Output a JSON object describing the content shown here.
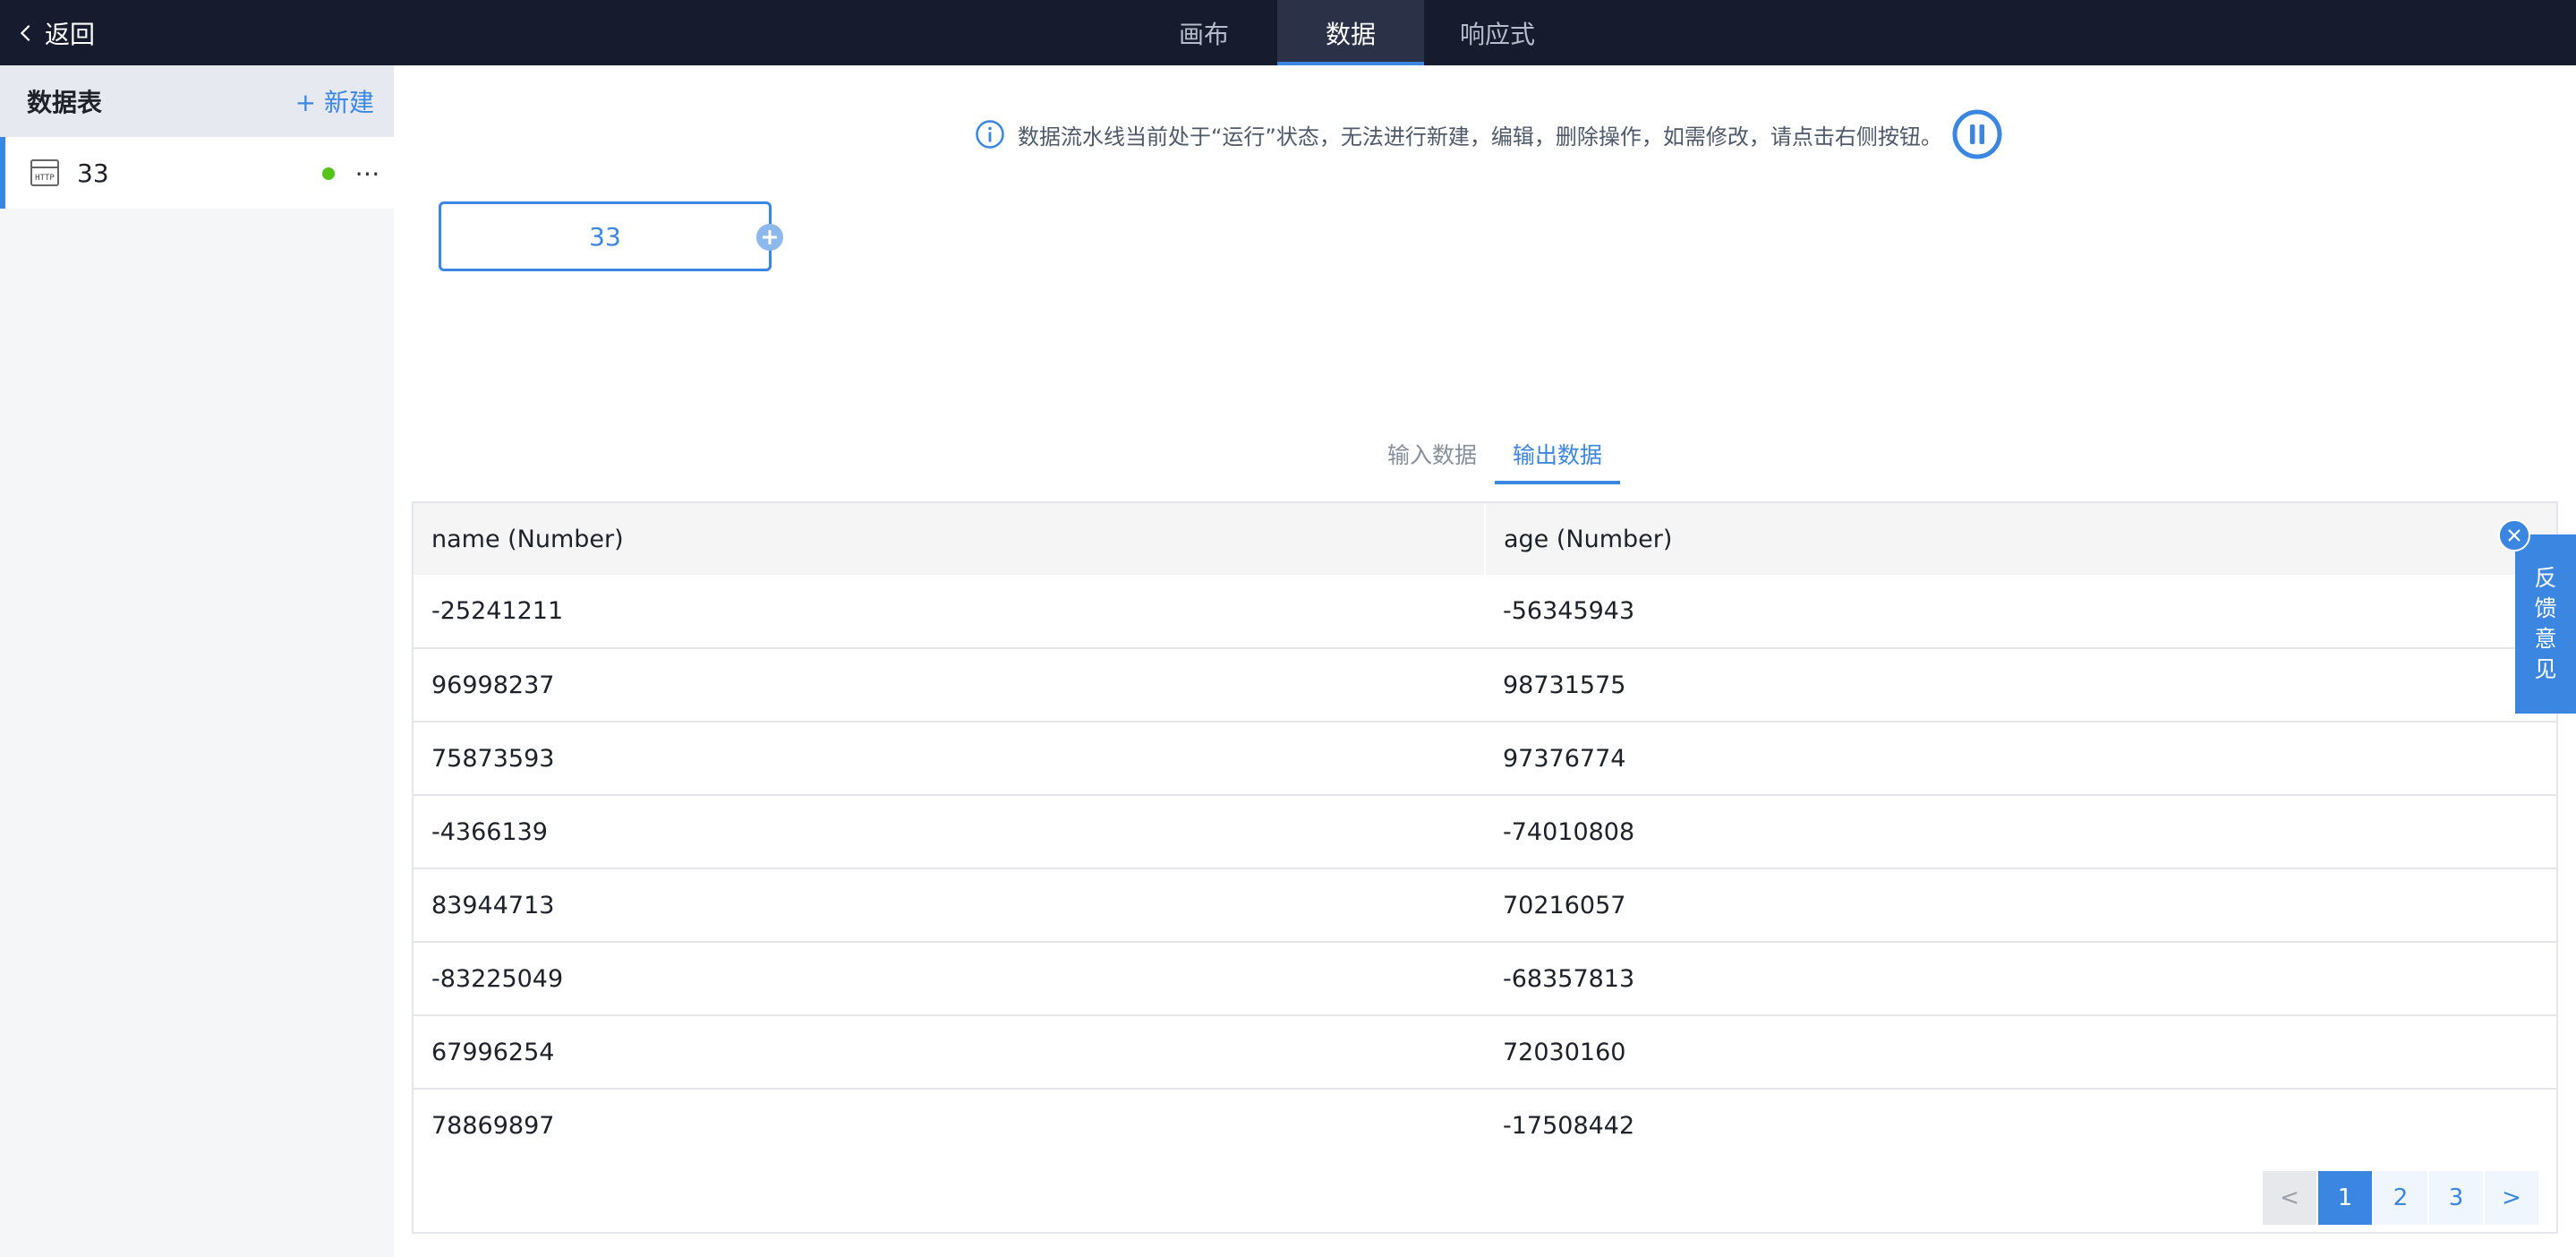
{
  "header": {
    "back_label": "返回",
    "tabs": [
      {
        "label": "画布",
        "active": false
      },
      {
        "label": "数据",
        "active": true
      },
      {
        "label": "响应式",
        "active": false
      }
    ]
  },
  "sidebar": {
    "title": "数据表",
    "new_label": "+ 新建",
    "items": [
      {
        "icon": "http-icon",
        "icon_text": "HTTP",
        "name": "33",
        "status": "running"
      }
    ]
  },
  "main": {
    "notice": "数据流水线当前处于“运行”状态，无法进行新建，编辑，删除操作，如需修改，请点击右侧按钮。",
    "node_label": "33",
    "data_tabs": [
      {
        "label": "输入数据",
        "active": false
      },
      {
        "label": "输出数据",
        "active": true
      }
    ],
    "table": {
      "columns": [
        "name (Number)",
        "age (Number)"
      ],
      "rows": [
        [
          "-25241211",
          "-56345943"
        ],
        [
          "96998237",
          "98731575"
        ],
        [
          "75873593",
          "97376774"
        ],
        [
          "-4366139",
          "-74010808"
        ],
        [
          "83944713",
          "70216057"
        ],
        [
          "-83225049",
          "-68357813"
        ],
        [
          "67996254",
          "72030160"
        ],
        [
          "78869897",
          "-17508442"
        ]
      ]
    },
    "pagination": {
      "prev": "<",
      "pages": [
        "1",
        "2",
        "3"
      ],
      "current": "1",
      "next": ">"
    }
  },
  "feedback": {
    "chars": [
      "反",
      "馈",
      "意",
      "见"
    ]
  },
  "colors": {
    "topbar": "#161b2e",
    "accent": "#3a86e0",
    "status_running": "#52c41a"
  }
}
